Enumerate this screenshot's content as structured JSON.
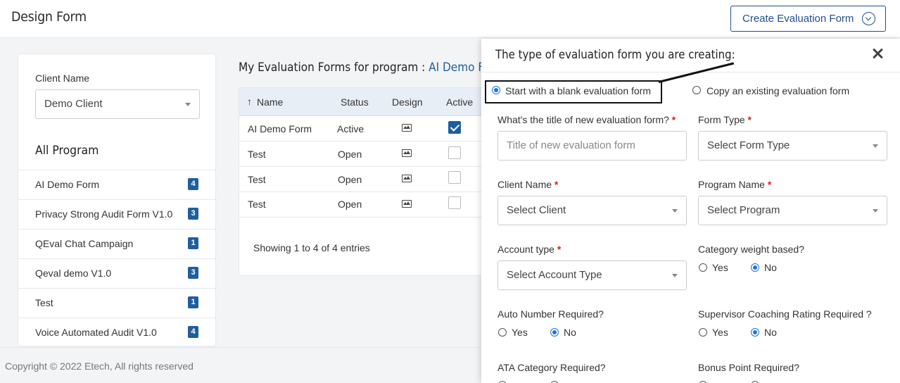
{
  "header": {
    "title": "Design Form",
    "create_button": "Create Evaluation Form"
  },
  "sidebar": {
    "client_label": "Client Name",
    "client_value": "Demo Client",
    "programs_heading": "All Program",
    "programs": [
      {
        "label": "AI Demo Form",
        "count": "4"
      },
      {
        "label": "Privacy Strong Audit Form V1.0",
        "count": "3"
      },
      {
        "label": "QEval Chat Campaign",
        "count": "1"
      },
      {
        "label": "Qeval demo V1.0",
        "count": "3"
      },
      {
        "label": "Test",
        "count": "1"
      },
      {
        "label": "Voice Automated Audit V1.0",
        "count": "4"
      }
    ]
  },
  "forms": {
    "heading_prefix": "My Evaluation Forms for program : ",
    "program_name": "AI Demo Form",
    "columns": {
      "sort_arrow": "↑",
      "name": "Name",
      "status": "Status",
      "design": "Design",
      "active": "Active"
    },
    "rows": [
      {
        "name": "AI Demo Form",
        "status": "Active",
        "active": true
      },
      {
        "name": "Test",
        "status": "Open",
        "active": false
      },
      {
        "name": "Test",
        "status": "Open",
        "active": false
      },
      {
        "name": "Test",
        "status": "Open",
        "active": false
      }
    ],
    "showing": "Showing 1 to 4 of 4 entries"
  },
  "footer": {
    "copyright": "Copyright © 2022 Etech, All rights reserved"
  },
  "panel": {
    "title": "The type of evaluation form you are creating:",
    "option_blank": "Start with a blank evaluation form",
    "option_copy": "Copy an existing evaluation form",
    "selected_option": "blank",
    "title_label": "What's the title of new evaluation form?",
    "title_placeholder": "Title of new evaluation form",
    "form_type_label": "Form Type",
    "form_type_value": "Select Form Type",
    "client_label": "Client Name",
    "client_value": "Select Client",
    "program_label": "Program Name",
    "program_value": "Select Program",
    "account_label": "Account type",
    "account_value": "Select Account Type",
    "category_weight_label": "Category weight based?",
    "category_weight_value": "No",
    "auto_number_label": "Auto Number Required?",
    "auto_number_value": "No",
    "coaching_label": "Supervisor Coaching Rating Required ?",
    "coaching_value": "No",
    "ata_label": "ATA Category Required?",
    "bonus_label": "Bonus Point Required?",
    "yes_label": "Yes",
    "no_label": "No",
    "required_mark": "*"
  }
}
